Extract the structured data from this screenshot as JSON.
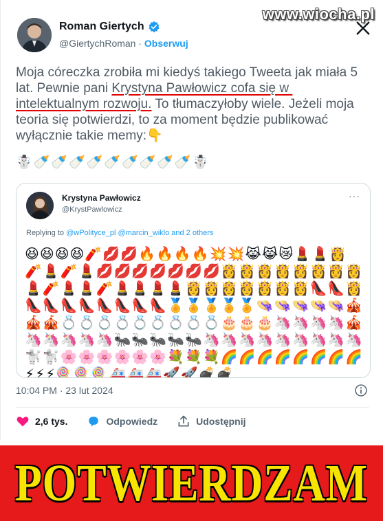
{
  "watermark": "www.wiocha.pl",
  "author": {
    "name": "Roman Giertych",
    "handle": "@GiertychRoman",
    "separator": "·",
    "follow_label": "Obserwuj"
  },
  "tweet": {
    "text_part1": "Moja córeczka zrobiła mi kiedyś takiego Tweeta jak miała 5 lat. Pewnie pani ",
    "text_underlined": "Krystyna Pawłowicz cofa się w intelektualnym rozwoju.",
    "text_part2": " To tłumaczyłoby wiele. Jeżeli moja teoria się potwierdzi, to za moment będzie publikować wyłącznie takie memy:👇",
    "emoji_line": "☃️🍼🍼🍼🍼🍼🍼🍼🍼🍼☃️"
  },
  "quoted": {
    "name": "Krystyna Pawłowicz",
    "handle": "@KrystPawlowicz",
    "more": "···",
    "replying_prefix": "Replying to ",
    "replying_mentions": "@wPolityce_pl @marcin_wiklo and 2 others",
    "emoji_rows": [
      "😆😆😆😆🧨💋💋🔥🔥🔥🔥💥💥😹😹😿💄💄👸",
      "🧨💄🧨💄💋💋💋💋💋💋💋👸👸👸👸👸👸👸👸",
      "💄🧨💄💄🧨💄💄💄💄👸👸👸👸👸👸👸👠👠👸",
      "👠👠👠👠👠👠👠👠🏅🏅🏅🏅🏅👒👒👒👒👒🎪",
      "🎪🎪💍💍💍💍💍💍💍💍💍🎂🎂🎂🦄🦄🦄🦄🎪",
      "🦄🦄🦄🦄🦄🐜🐜🐜🐜🐜🦄🦄🦄🦄🦄🦄🦄🦄🦄",
      "🐩🐩🌸🌸🌸🌸🌸🌸💐💐💐🌈🌈🌈🌈🌈🌈🌈🌈",
      "⚡⚡⚡🍭🍭🍭🚑🚑🚑🚀🚀💣💣"
    ]
  },
  "meta": {
    "timestamp": "10:04 PM · 23 lut 2024"
  },
  "actions": {
    "likes": "2,6 tys.",
    "reply_label": "Odpowiedz",
    "share_label": "Udostępnij"
  },
  "banner": {
    "text": "POTWIERDZAM"
  },
  "colors": {
    "accent": "#1d9bf0",
    "like": "#f91880",
    "banner_bg": "#e61a1a",
    "banner_text": "#f7e400",
    "underline": "#e00000"
  }
}
